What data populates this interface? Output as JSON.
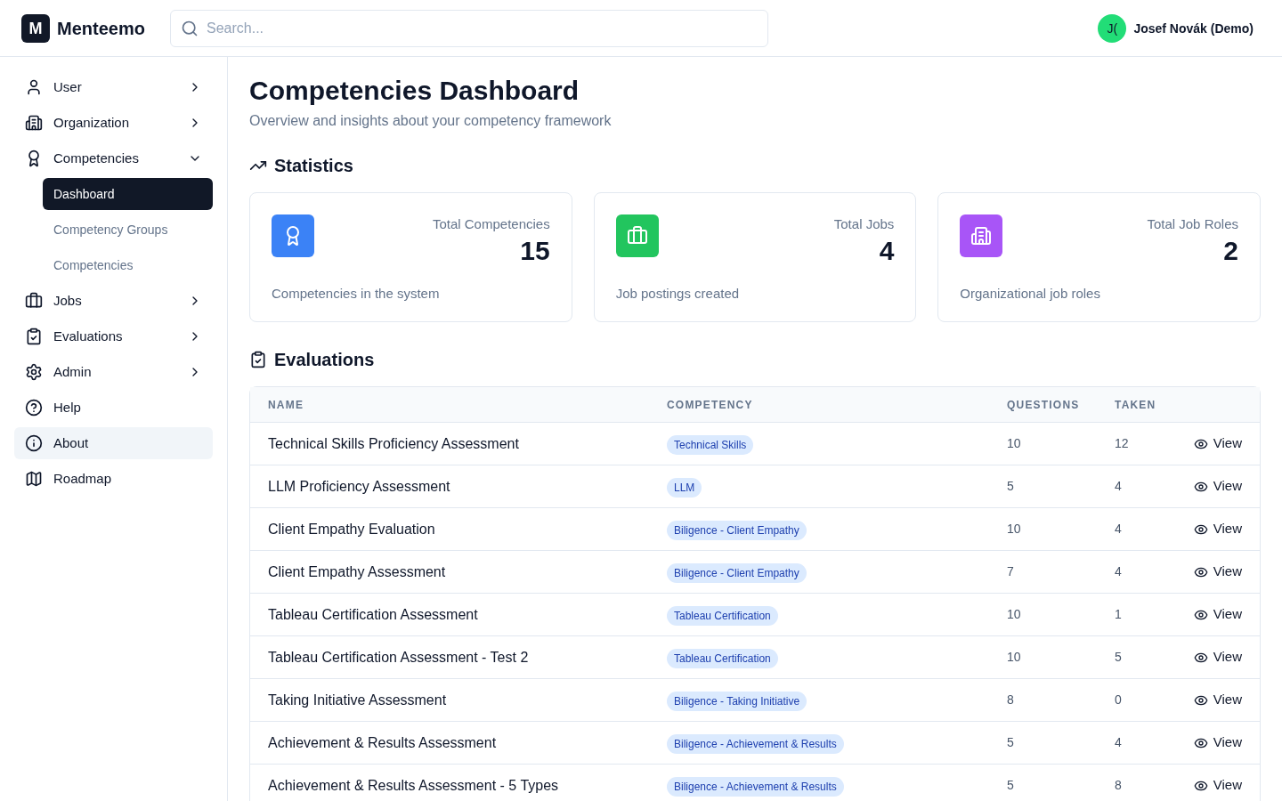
{
  "brand": {
    "logo": "M",
    "name": "Menteemo"
  },
  "search": {
    "placeholder": "Search..."
  },
  "user": {
    "initials": "J(",
    "name": "Josef Novák (Demo)"
  },
  "sidebar": {
    "items": [
      {
        "label": "User",
        "expanded": false,
        "highlighted": false
      },
      {
        "label": "Organization",
        "expanded": false,
        "highlighted": false
      },
      {
        "label": "Competencies",
        "expanded": true,
        "highlighted": false,
        "children": [
          {
            "label": "Dashboard",
            "selected": true
          },
          {
            "label": "Competency Groups",
            "selected": false
          },
          {
            "label": "Competencies",
            "selected": false
          }
        ]
      },
      {
        "label": "Jobs",
        "expanded": false,
        "highlighted": false
      },
      {
        "label": "Evaluations",
        "expanded": false,
        "highlighted": false
      },
      {
        "label": "Admin",
        "expanded": false,
        "highlighted": false
      },
      {
        "label": "Help",
        "highlighted": false
      },
      {
        "label": "About",
        "highlighted": true
      },
      {
        "label": "Roadmap",
        "highlighted": false
      }
    ]
  },
  "page": {
    "title": "Competencies Dashboard",
    "subtitle": "Overview and insights about your competency framework"
  },
  "statistics": {
    "title": "Statistics",
    "cards": [
      {
        "color": "#3b82f6",
        "label": "Total Competencies",
        "value": "15",
        "caption": "Competencies in the system"
      },
      {
        "color": "#22c55e",
        "label": "Total Jobs",
        "value": "4",
        "caption": "Job postings created"
      },
      {
        "color": "#a855f7",
        "label": "Total Job Roles",
        "value": "2",
        "caption": "Organizational job roles"
      }
    ]
  },
  "evaluations": {
    "title": "Evaluations",
    "columns": [
      "NAME",
      "COMPETENCY",
      "QUESTIONS",
      "TAKEN"
    ],
    "rows": [
      {
        "name": "Technical Skills Proficiency Assessment",
        "competency": "Technical Skills",
        "questions": "10",
        "taken": "12",
        "action": "View"
      },
      {
        "name": "LLM Proficiency Assessment",
        "competency": "LLM",
        "questions": "5",
        "taken": "4",
        "action": "View"
      },
      {
        "name": "Client Empathy Evaluation",
        "competency": "Biligence - Client Empathy",
        "questions": "10",
        "taken": "4",
        "action": "View"
      },
      {
        "name": "Client Empathy Assessment",
        "competency": "Biligence - Client Empathy",
        "questions": "7",
        "taken": "4",
        "action": "View"
      },
      {
        "name": "Tableau Certification Assessment",
        "competency": "Tableau Certification",
        "questions": "10",
        "taken": "1",
        "action": "View"
      },
      {
        "name": "Tableau Certification Assessment - Test 2",
        "competency": "Tableau Certification",
        "questions": "10",
        "taken": "5",
        "action": "View"
      },
      {
        "name": "Taking Initiative Assessment",
        "competency": "Biligence - Taking Initiative",
        "questions": "8",
        "taken": "0",
        "action": "View"
      },
      {
        "name": "Achievement & Results Assessment",
        "competency": "Biligence - Achievement & Results",
        "questions": "5",
        "taken": "4",
        "action": "View"
      },
      {
        "name": "Achievement & Results Assessment - 5 Types",
        "competency": "Biligence - Achievement & Results",
        "questions": "5",
        "taken": "8",
        "action": "View"
      }
    ]
  }
}
